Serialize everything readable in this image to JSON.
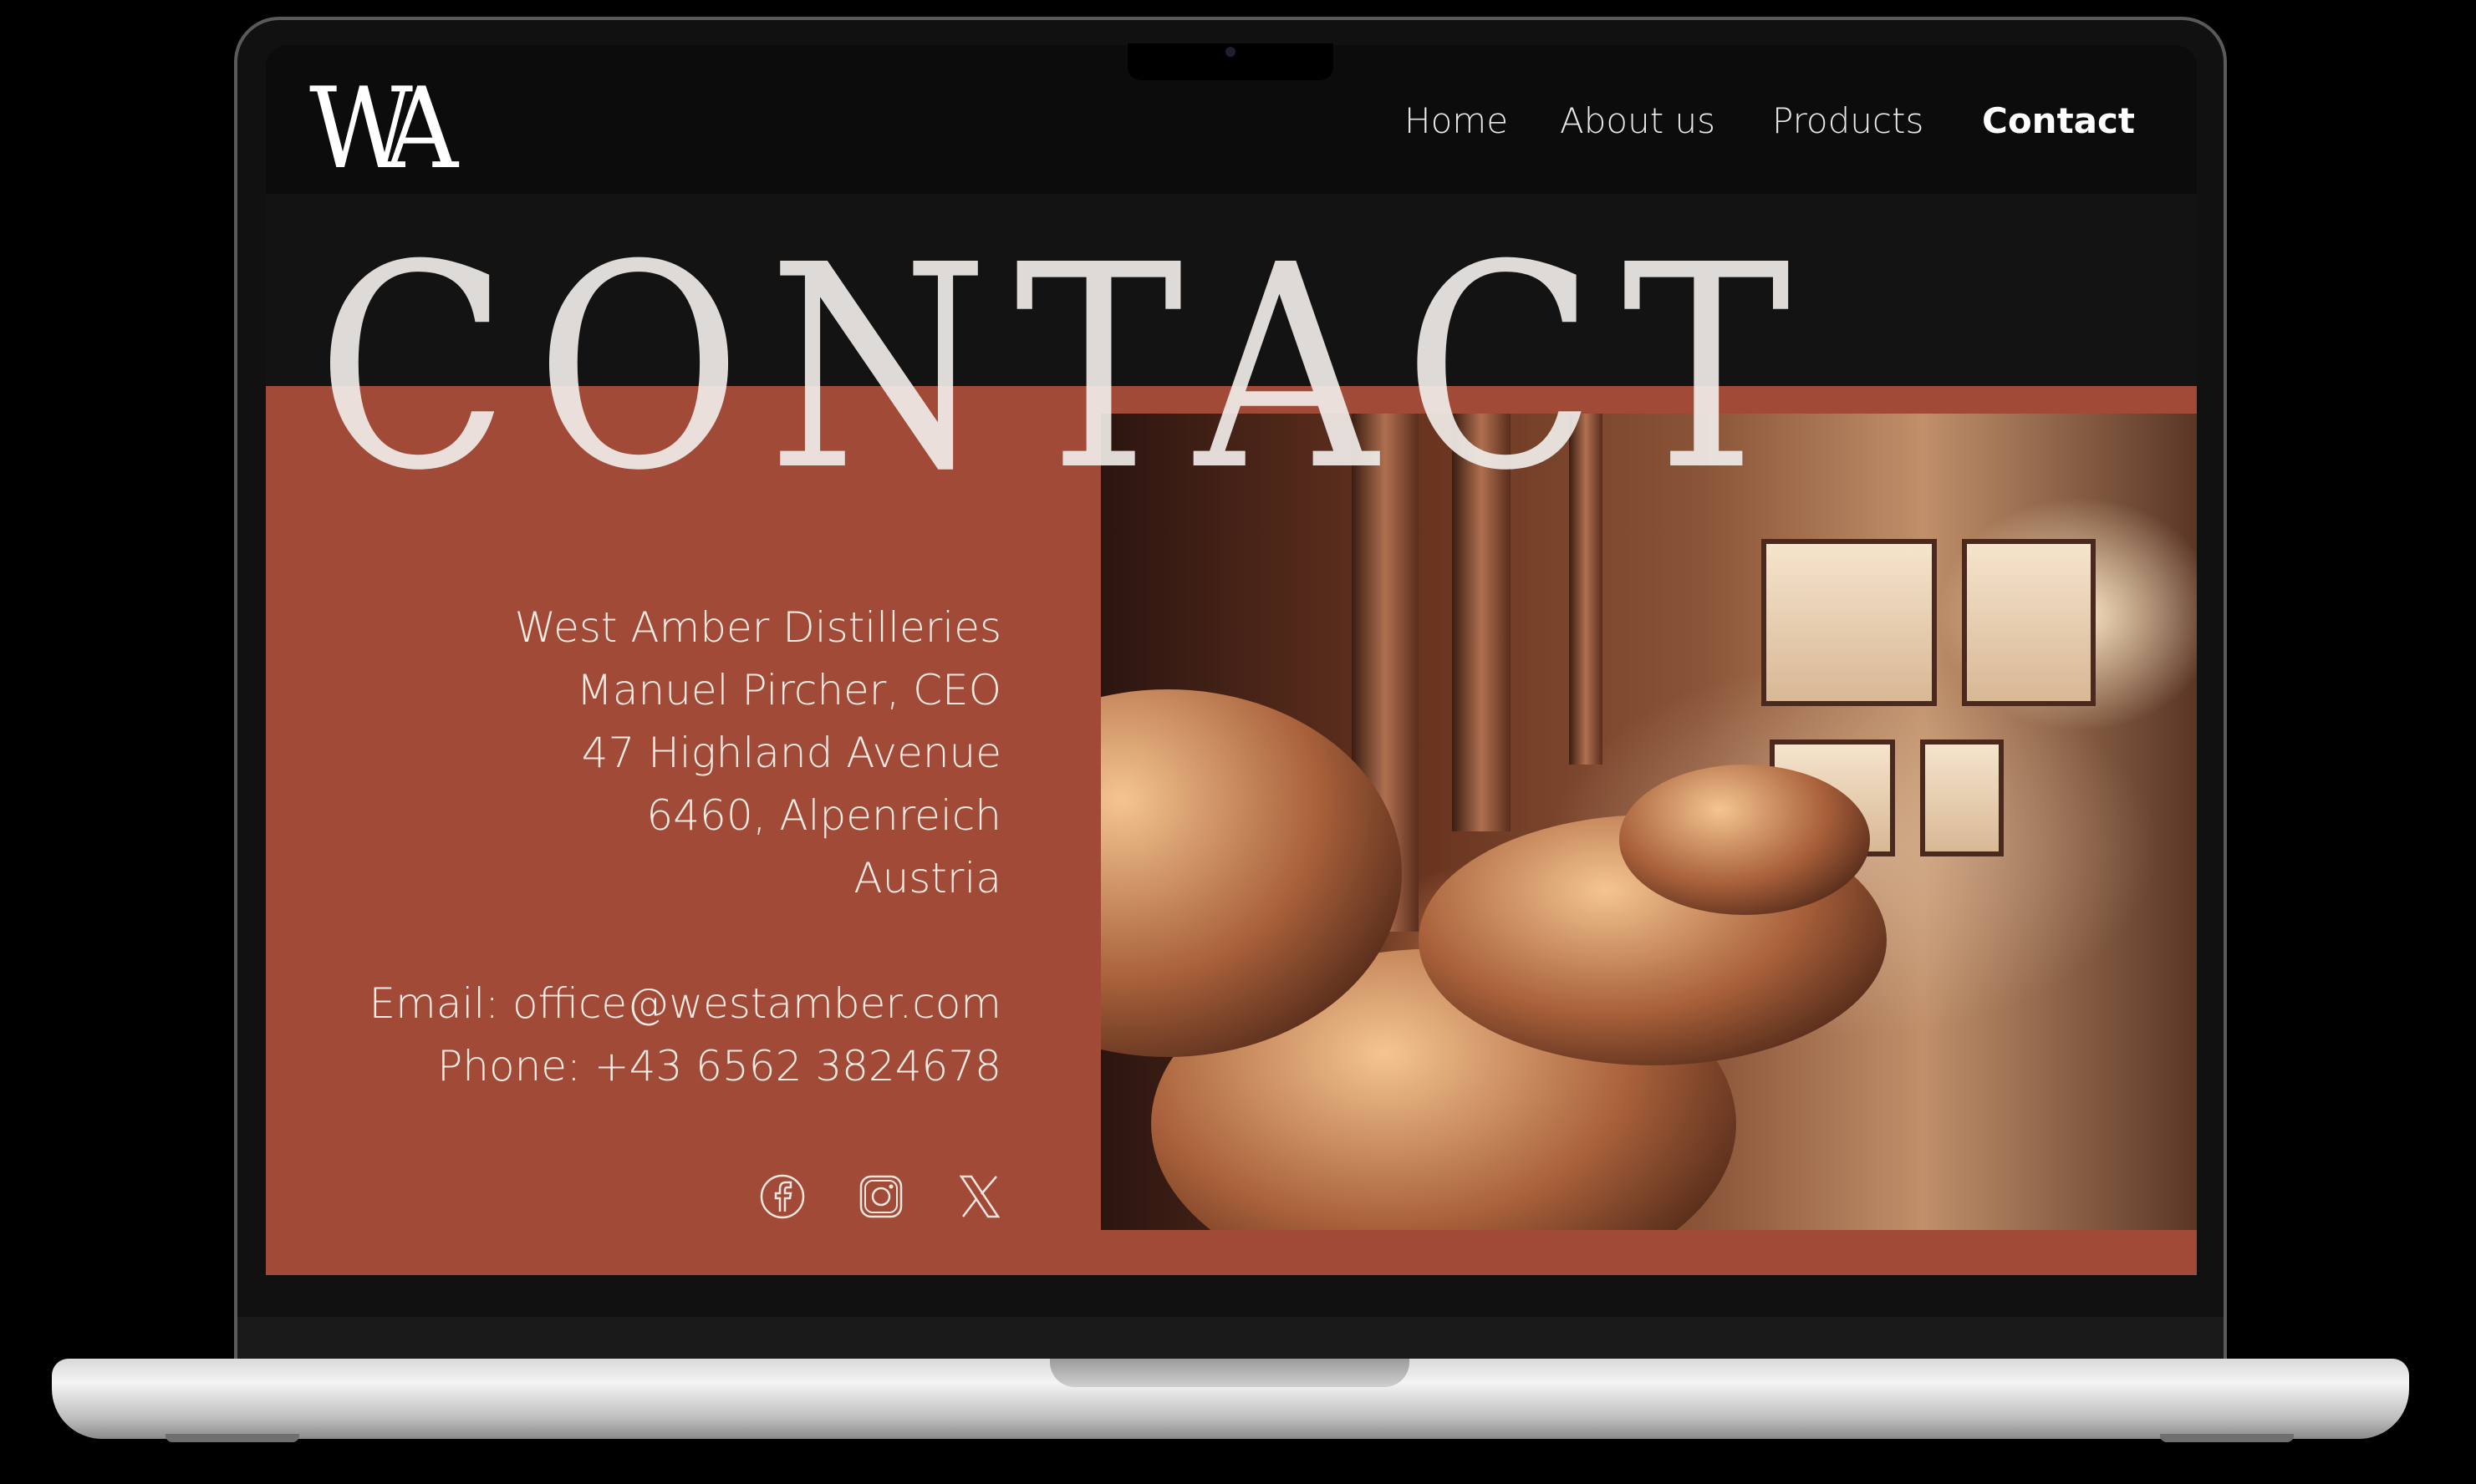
{
  "brand": {
    "logo_text": "WA"
  },
  "nav": {
    "items": [
      {
        "label": "Home",
        "active": false
      },
      {
        "label": "About us",
        "active": false
      },
      {
        "label": "Products",
        "active": false
      },
      {
        "label": "Contact",
        "active": true
      }
    ]
  },
  "hero": {
    "title": "CONTACT"
  },
  "contact": {
    "company": "West Amber Distilleries",
    "person": "Manuel Pircher, CEO",
    "street": "47 Highland Avenue",
    "city": "6460, Alpenreich",
    "country": "Austria",
    "email": "Email: office@westamber.com",
    "phone": "Phone: +43 6562 3824678"
  },
  "socials": [
    {
      "icon": "facebook-icon"
    },
    {
      "icon": "instagram-icon"
    },
    {
      "icon": "x-icon"
    }
  ],
  "colors": {
    "accent": "#a04a37",
    "nav_bg": "#0c0c0c",
    "page_bg": "#131313"
  }
}
